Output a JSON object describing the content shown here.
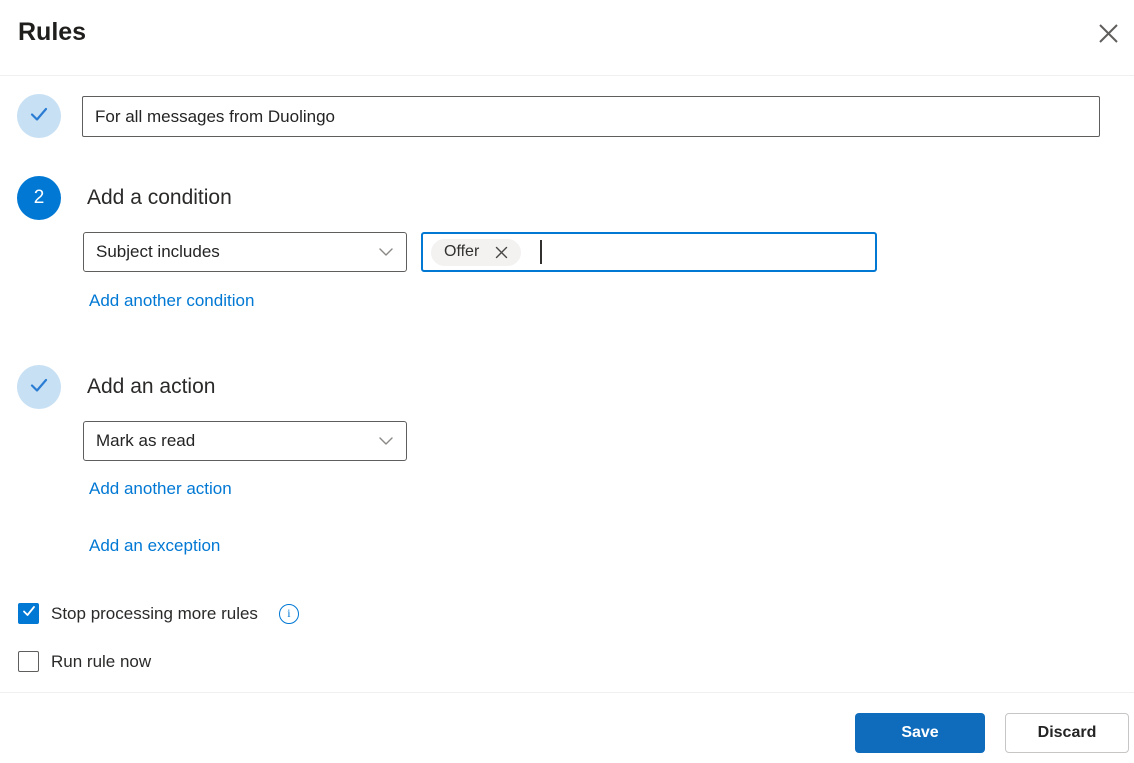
{
  "dialog": {
    "title": "Rules"
  },
  "colors": {
    "accent": "#0078d4",
    "save_button": "#0f6cbd",
    "step_done_bg": "#c7e0f4",
    "link": "#0078d4"
  },
  "icons": {
    "close": "close-icon",
    "check": "checkmark-icon",
    "chevron": "chevron-down-icon",
    "info": "info-icon",
    "tag_remove": "remove-tag-icon"
  },
  "step1": {
    "rule_name_value": "For all messages from Duolingo"
  },
  "step2": {
    "number": "2",
    "heading": "Add a condition",
    "condition_selected": "Subject includes",
    "condition_tag": "Offer",
    "add_link": "Add another condition"
  },
  "step3": {
    "heading": "Add an action",
    "action_selected": "Mark as read",
    "add_link": "Add another action",
    "exception_link": "Add an exception"
  },
  "options": {
    "stop_processing_label": "Stop processing more rules",
    "stop_processing_checked": true,
    "run_rule_label": "Run rule now",
    "run_rule_checked": false
  },
  "footer": {
    "save_label": "Save",
    "discard_label": "Discard"
  }
}
